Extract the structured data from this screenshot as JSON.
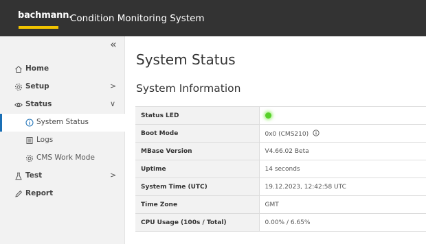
{
  "header": {
    "logo_text": "bachmann.",
    "app_title": "Condition Monitoring System",
    "accent_color": "#f2c400",
    "background_color": "#333333"
  },
  "sidebar": {
    "collapse_glyph": "«",
    "items": [
      {
        "label": "Home",
        "icon": "home-icon",
        "level": 1
      },
      {
        "label": "Setup",
        "icon": "gear-icon",
        "level": 1,
        "expand": "collapsed"
      },
      {
        "label": "Status",
        "icon": "eye-icon",
        "level": 1,
        "expand": "expanded"
      },
      {
        "label": "System Status",
        "icon": "info-icon",
        "level": 2,
        "active": true
      },
      {
        "label": "Logs",
        "icon": "logs-icon",
        "level": 2
      },
      {
        "label": "CMS Work Mode",
        "icon": "gear-icon",
        "level": 2
      },
      {
        "label": "Test",
        "icon": "flask-icon",
        "level": 1,
        "expand": "collapsed"
      },
      {
        "label": "Report",
        "icon": "pen-icon",
        "level": 1
      }
    ],
    "chevron_right": ">",
    "chevron_down": "∨"
  },
  "main": {
    "page_title": "System Status",
    "section_title": "System Information",
    "rows": [
      {
        "label": "Status LED",
        "value": "",
        "indicator": "green"
      },
      {
        "label": "Boot Mode",
        "value": "0x0 (CMS210)",
        "icon": "info-icon"
      },
      {
        "label": "MBase Version",
        "value": "V4.66.02 Beta"
      },
      {
        "label": "Uptime",
        "value": "14 seconds"
      },
      {
        "label": "System Time (UTC)",
        "value": "19.12.2023, 12:42:58 UTC"
      },
      {
        "label": "Time Zone",
        "value": "GMT"
      },
      {
        "label": "CPU Usage (100s / Total)",
        "value": "0.00% / 6.65%"
      }
    ]
  }
}
